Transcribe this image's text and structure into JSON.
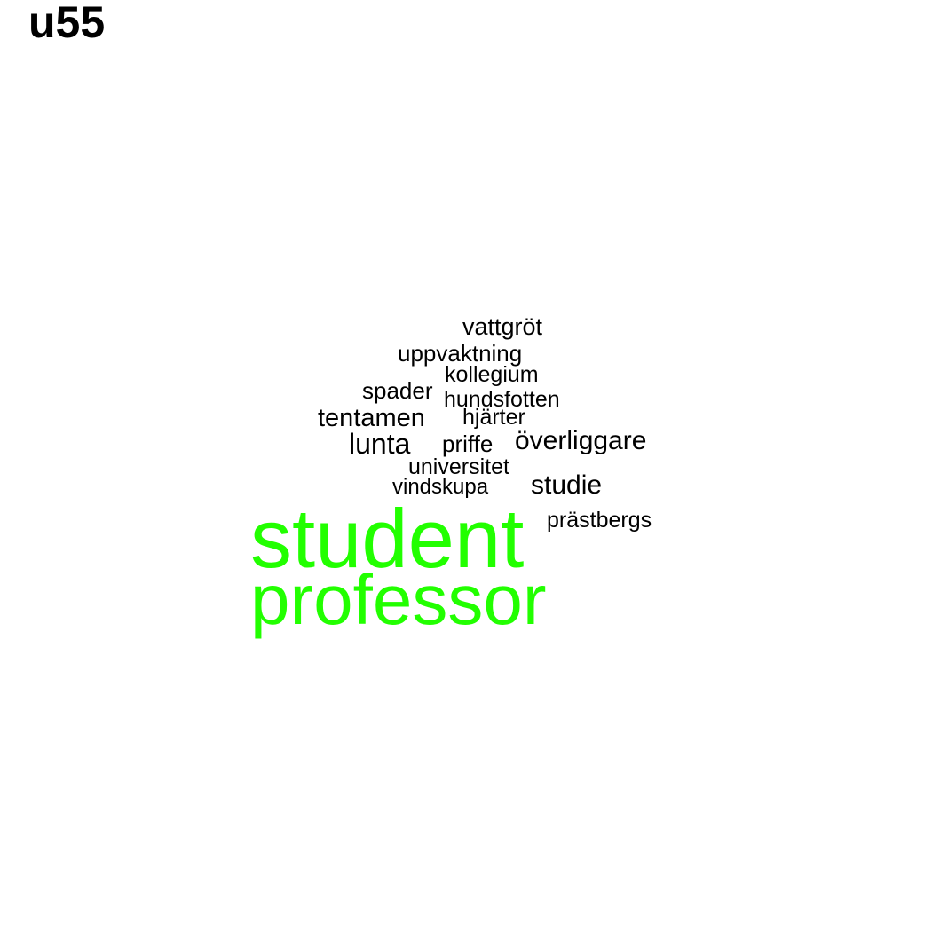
{
  "title": "u55",
  "colors": {
    "highlight": "#22ff00",
    "normal": "#000000",
    "background": "#ffffff"
  },
  "words": [
    {
      "text": "vattgröt",
      "highlight": false
    },
    {
      "text": "uppvaktning",
      "highlight": false
    },
    {
      "text": "kollegium",
      "highlight": false
    },
    {
      "text": "spader",
      "highlight": false
    },
    {
      "text": "hundsfotten",
      "highlight": false
    },
    {
      "text": "tentamen",
      "highlight": false
    },
    {
      "text": "hjärter",
      "highlight": false
    },
    {
      "text": "lunta",
      "highlight": false
    },
    {
      "text": "priffe",
      "highlight": false
    },
    {
      "text": "överliggare",
      "highlight": false
    },
    {
      "text": "universitet",
      "highlight": false
    },
    {
      "text": "vindskupa",
      "highlight": false
    },
    {
      "text": "studie",
      "highlight": false
    },
    {
      "text": "prästbergs",
      "highlight": false
    },
    {
      "text": "student",
      "highlight": true
    },
    {
      "text": "professor",
      "highlight": true
    }
  ]
}
